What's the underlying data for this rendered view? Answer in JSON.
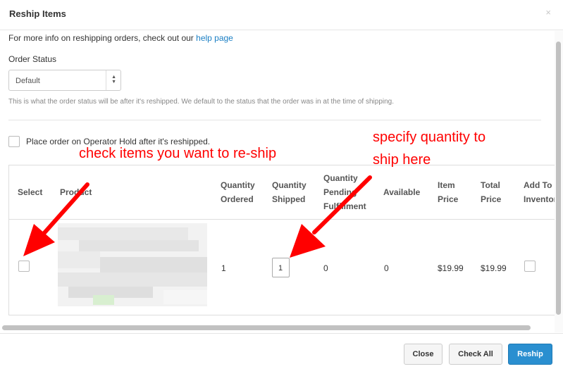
{
  "modal": {
    "title": "Reship Items",
    "close_glyph": "×"
  },
  "info": {
    "text": "For more info on reshipping orders, check out our ",
    "link": "help page"
  },
  "order_status": {
    "label": "Order Status",
    "value": "Default",
    "help": "This is what the order status will be after it's reshipped. We default to the status that the order was in at the time of shipping."
  },
  "operator_hold": {
    "label": "Place order on Operator Hold after it's reshipped.",
    "checked": false
  },
  "table": {
    "headers": {
      "select": "Select",
      "product": "Product",
      "qty_ordered_1": "Quantity",
      "qty_ordered_2": "Ordered",
      "qty_shipped_1": "Quantity",
      "qty_shipped_2": "Shipped",
      "qty_pending_1": "Quantity",
      "qty_pending_2": "Pending",
      "qty_pending_3": "Fulfillment",
      "available": "Available",
      "item_price_1": "Item",
      "item_price_2": "Price",
      "total_price_1": "Total",
      "total_price_2": "Price",
      "add_to_1": "Add To",
      "add_to_2": "Inventory"
    },
    "rows": [
      {
        "selected": false,
        "quantity_ordered": "1",
        "quantity_shipped": "1",
        "quantity_pending": "0",
        "available": "0",
        "item_price": "$19.99",
        "total_price": "$19.99",
        "add_to_inventory": false
      }
    ]
  },
  "footer": {
    "close_label": "Close",
    "check_all_label": "Check All",
    "reship_label": "Reship"
  },
  "annotations": {
    "check_items": "check items you want to re-ship",
    "specify_qty_1": "specify quantity to",
    "specify_qty_2": "ship here",
    "color": "#ff0000"
  }
}
